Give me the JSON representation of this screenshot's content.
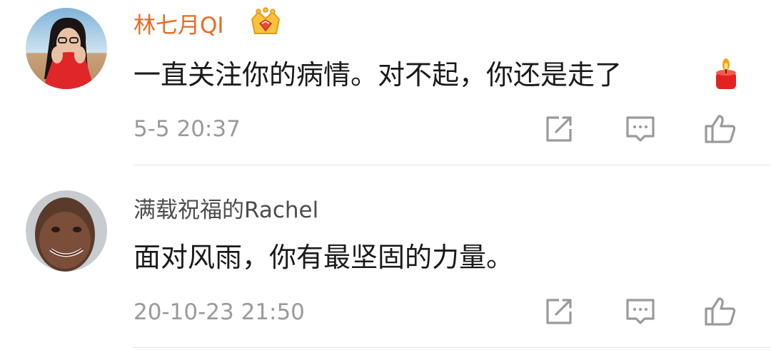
{
  "comments": [
    {
      "username": "林七月QI",
      "badge_icon": "crown-vip-icon",
      "content": "一直关注你的病情。对不起，你还是走了",
      "emoji_icon": "candle-icon",
      "timestamp": "5-5 20:37",
      "actions": [
        "share-icon",
        "reply-icon",
        "like-icon"
      ],
      "username_color": "#e86b25"
    },
    {
      "username": "满载祝福的Rachel",
      "content": "面对风雨，你有最坚固的力量。",
      "timestamp": "20-10-23 21:50",
      "actions": [
        "share-icon",
        "reply-icon",
        "like-icon"
      ],
      "username_color": "#4d4d4d"
    }
  ],
  "colors": {
    "timestamp": "#9a9a9a",
    "icon": "#9a9a9a",
    "divider": "#e6e6e6"
  }
}
